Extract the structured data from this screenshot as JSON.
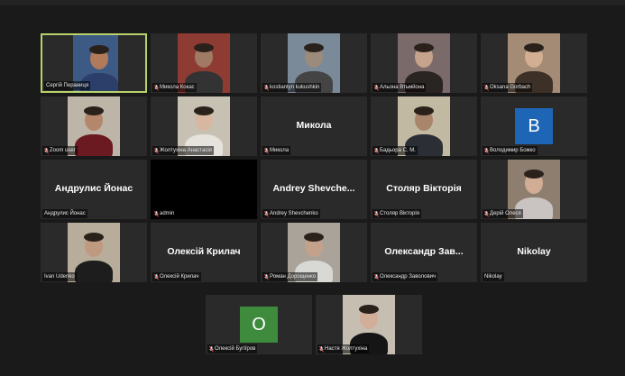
{
  "meeting": {
    "participants": [
      {
        "name": "Сергій Пераниця",
        "display": "",
        "mic": "on",
        "active": true,
        "bg": "#3c5a84",
        "skin": "#b07a5b",
        "shirt": "#2c3e6a"
      },
      {
        "name": "Микола Кокас",
        "display": "",
        "mic": "muted",
        "active": false,
        "bg": "#8e3b33",
        "skin": "#a17a65",
        "shirt": "#333"
      },
      {
        "name": "kostiantyn kukushkin",
        "display": "",
        "mic": "muted",
        "active": false,
        "bg": "#7b8a99",
        "skin": "#9c8a7a",
        "shirt": "#444"
      },
      {
        "name": "Альона Втьмйона",
        "display": "",
        "mic": "muted",
        "active": false,
        "bg": "#7a6a6a",
        "skin": "#c6a38c",
        "shirt": "#2a2422"
      },
      {
        "name": "Oksana Gorbach",
        "display": "",
        "mic": "muted",
        "active": false,
        "bg": "#a38b76",
        "skin": "#d2ae93",
        "shirt": "#3d3127"
      },
      {
        "name": "Zoom user",
        "display": "",
        "mic": "muted",
        "active": false,
        "bg": "#bdb5a7",
        "skin": "#b4876c",
        "shirt": "#6b1a22"
      },
      {
        "name": "Жолтухіна Анастасія",
        "display": "",
        "mic": "muted",
        "active": false,
        "bg": "#c7c1b4",
        "skin": "#d8b7a1",
        "shirt": "#e6e2dc"
      },
      {
        "name": "Микола",
        "display": "Микола",
        "mic": "muted",
        "active": false
      },
      {
        "name": "Бадьора С. М.",
        "display": "",
        "mic": "muted",
        "active": false,
        "bg": "#c2b9a3",
        "skin": "#a9856b",
        "shirt": "#2b2f35"
      },
      {
        "name": "Володимир Божко",
        "display": "",
        "mic": "muted",
        "active": false,
        "letter": "B",
        "letterbg": "#1e66b5"
      },
      {
        "name": "Андрулис Йонас",
        "display": "Андрулис Йонас",
        "mic": "on",
        "active": false
      },
      {
        "name": "admin",
        "display": "",
        "mic": "muted",
        "active": false,
        "dark": true
      },
      {
        "name": "Andrey Shevchenko",
        "display": "Andrey  Shevche...",
        "mic": "muted",
        "active": false
      },
      {
        "name": "Столяр Вікторія",
        "display": "Столяр Вікторія",
        "mic": "muted",
        "active": false
      },
      {
        "name": "Дерій Олеся",
        "display": "",
        "mic": "muted",
        "active": false,
        "bg": "#8d7e70",
        "skin": "#d1ad95",
        "shirt": "#c9c4c1"
      },
      {
        "name": "Ivan Udenko",
        "display": "",
        "mic": "on",
        "active": false,
        "bg": "#b7ad9a",
        "skin": "#c09a80",
        "shirt": "#1d1d1d"
      },
      {
        "name": "Олексій Крилач",
        "display": "Олексій Крилач",
        "mic": "muted",
        "active": false
      },
      {
        "name": "Роман Дорощенко",
        "display": "",
        "mic": "muted",
        "active": false,
        "bg": "#a9a39a",
        "skin": "#c4a18a",
        "shirt": "#d8d8d4"
      },
      {
        "name": "Олександр Заволович",
        "display": "Олександр  Зав...",
        "mic": "muted",
        "active": false
      },
      {
        "name": "Nikolay",
        "display": "Nikolay",
        "mic": "on",
        "active": false
      },
      {
        "name": "Олексій Бугіїров",
        "display": "",
        "mic": "muted",
        "active": false,
        "letter": "O",
        "letterbg": "#3e8b3e"
      },
      {
        "name": "Настя Жолтухіна",
        "display": "",
        "mic": "muted",
        "active": false,
        "bg": "#c6beb0",
        "skin": "#d2ad98",
        "shirt": "#151515"
      }
    ]
  },
  "colors": {
    "background": "#1a1a1a",
    "tile": "#2a2a2a",
    "active_border": "#b9d36b",
    "muted_icon": "#e0403a"
  }
}
